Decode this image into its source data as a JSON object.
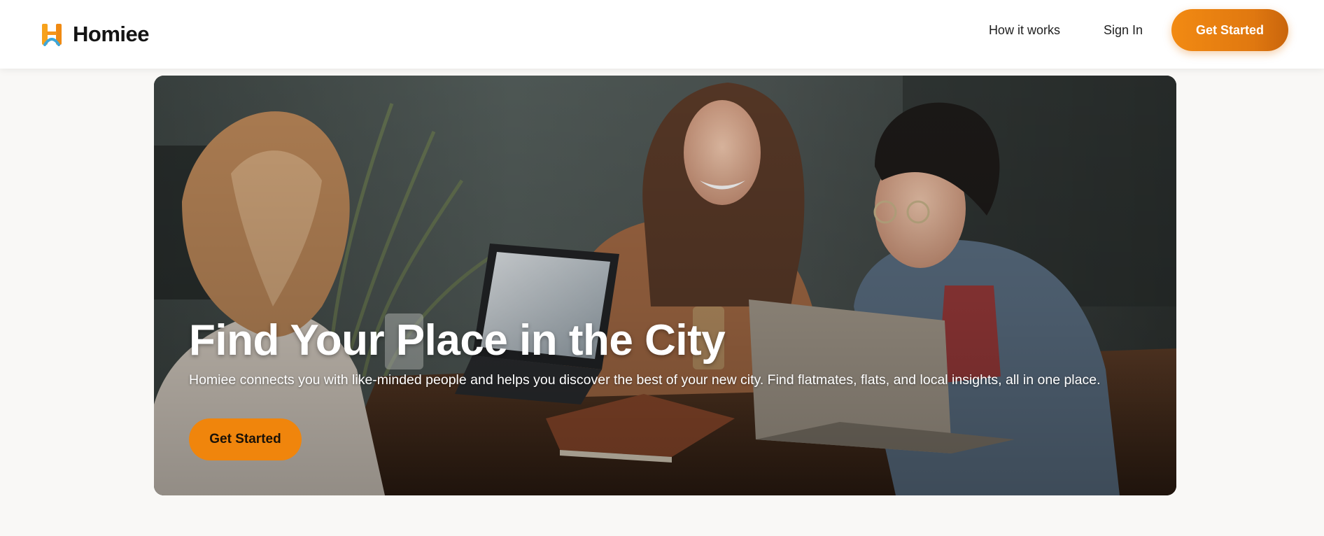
{
  "brand": {
    "name": "Homiee",
    "logo_icon": "homiee-h-logo-icon",
    "logo_colors": {
      "left_post": "#f7a21b",
      "right_post": "#f08a12",
      "arch": "#3ea6d9"
    }
  },
  "nav": {
    "how_it_works": "How it works",
    "sign_in": "Sign In",
    "cta": "Get Started"
  },
  "hero": {
    "image": "friends-laughing-laptops-cafe-photo",
    "title": "Find Your Place in the City",
    "subtitle": "Homiee connects you with like-minded people and helps you discover the best of your new city. Find flatmates, flats, and local insights, all in one place.",
    "cta": "Get Started"
  },
  "colors": {
    "accent": "#f0850c",
    "accent_dark": "#c9650c",
    "background": "#f9f8f6",
    "header_bg": "#ffffff",
    "text": "#1b1b1b"
  }
}
